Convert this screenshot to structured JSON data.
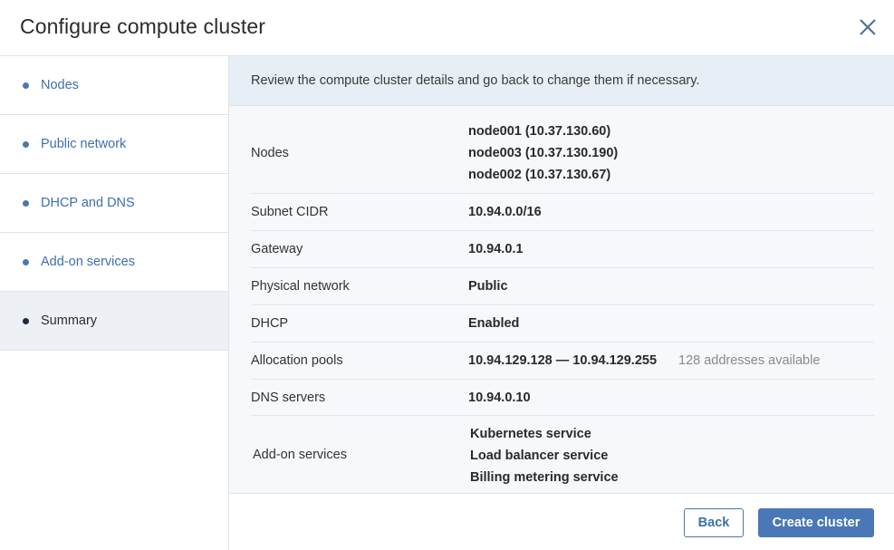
{
  "dialog": {
    "title": "Configure compute cluster"
  },
  "sidebar": {
    "steps": [
      {
        "label": "Nodes"
      },
      {
        "label": "Public network"
      },
      {
        "label": "DHCP and DNS"
      },
      {
        "label": "Add-on services"
      },
      {
        "label": "Summary",
        "active": true
      }
    ]
  },
  "summary": {
    "intro": "Review the compute cluster details and go back to change them if necessary.",
    "nodes": {
      "label": "Nodes",
      "values": [
        "node001 (10.37.130.60)",
        "node003 (10.37.130.190)",
        "node002 (10.37.130.67)"
      ]
    },
    "subnet_cidr": {
      "label": "Subnet CIDR",
      "value": "10.94.0.0/16"
    },
    "gateway": {
      "label": "Gateway",
      "value": "10.94.0.1"
    },
    "physical_network": {
      "label": "Physical network",
      "value": "Public"
    },
    "dhcp": {
      "label": "DHCP",
      "value": "Enabled"
    },
    "allocation_pools": {
      "label": "Allocation pools",
      "value": "10.94.129.128 — 10.94.129.255",
      "note": "128 addresses available"
    },
    "dns_servers": {
      "label": "DNS servers",
      "value": "10.94.0.10"
    },
    "addon_services": {
      "label": "Add-on services",
      "values": [
        "Kubernetes service",
        "Load balancer service",
        "Billing metering service"
      ]
    }
  },
  "footer": {
    "back_label": "Back",
    "create_label": "Create cluster"
  },
  "colors": {
    "accent": "#4a78b6",
    "link": "#3e6fae",
    "active_step_bg": "#edf1f6",
    "banner_bg": "#e8eef5"
  },
  "icons": {
    "close": "close-icon",
    "step_bullet": "bullet-dot"
  }
}
